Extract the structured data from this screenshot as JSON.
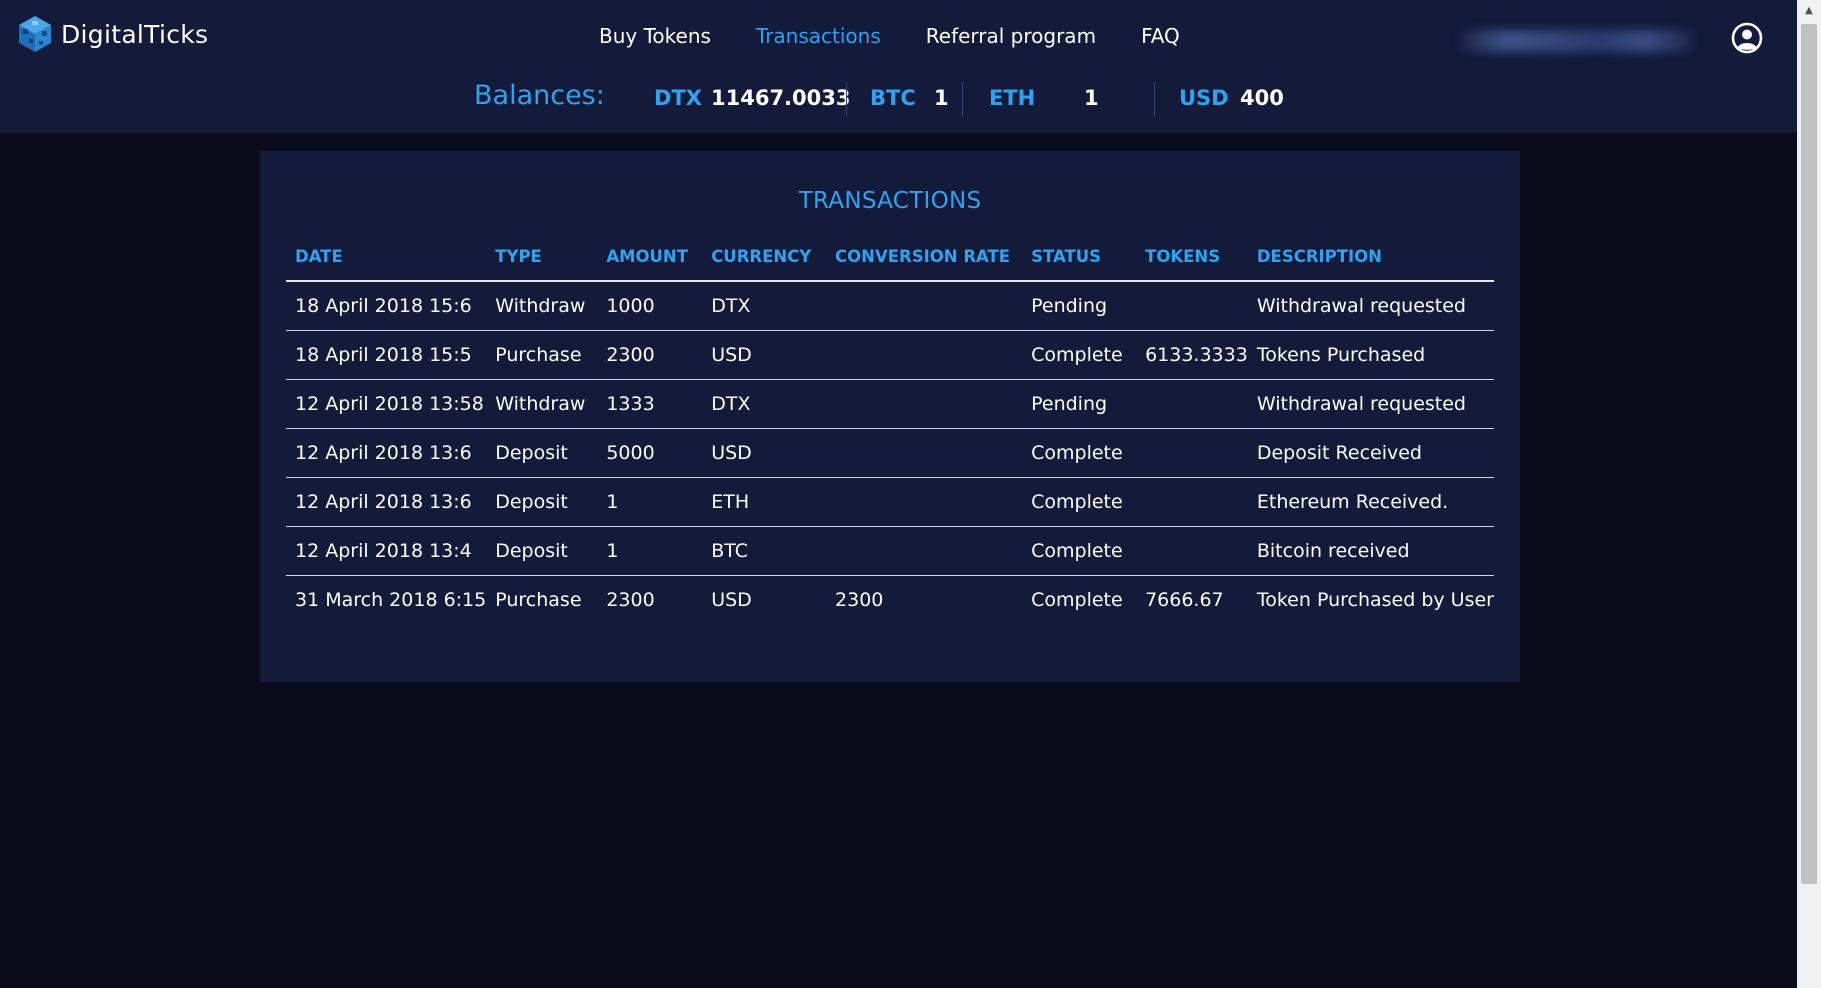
{
  "app": {
    "name": "DigitalTicks",
    "logo_icon": "cube-logo-icon"
  },
  "nav": {
    "items": [
      {
        "label": "Buy Tokens",
        "active": false
      },
      {
        "label": "Transactions",
        "active": true
      },
      {
        "label": "Referral program",
        "active": false
      },
      {
        "label": "FAQ",
        "active": false
      }
    ]
  },
  "user": {
    "icon": "user-circle-icon"
  },
  "balances": {
    "title": "Balances:",
    "items": [
      {
        "currency": "DTX",
        "value": "11467.0033"
      },
      {
        "currency": "BTC",
        "value": "1"
      },
      {
        "currency": "ETH",
        "value": "1"
      },
      {
        "currency": "USD",
        "value": "400"
      }
    ]
  },
  "transactions": {
    "title": "TRANSACTIONS",
    "columns": [
      "DATE",
      "TYPE",
      "AMOUNT",
      "CURRENCY",
      "CONVERSION RATE",
      "STATUS",
      "TOKENS",
      "DESCRIPTION"
    ],
    "rows": [
      {
        "date": "18 April 2018 15:6",
        "type": "Withdraw",
        "amount": "1000",
        "currency": "DTX",
        "conversion_rate": "",
        "status": "Pending",
        "tokens": "",
        "description": "Withdrawal requested"
      },
      {
        "date": "18 April 2018 15:5",
        "type": "Purchase",
        "amount": "2300",
        "currency": "USD",
        "conversion_rate": "",
        "status": "Complete",
        "tokens": "6133.3333",
        "description": "Tokens Purchased"
      },
      {
        "date": "12 April 2018 13:58",
        "type": "Withdraw",
        "amount": "1333",
        "currency": "DTX",
        "conversion_rate": "",
        "status": "Pending",
        "tokens": "",
        "description": "Withdrawal requested"
      },
      {
        "date": "12 April 2018 13:6",
        "type": "Deposit",
        "amount": "5000",
        "currency": "USD",
        "conversion_rate": "",
        "status": "Complete",
        "tokens": "",
        "description": "Deposit Received"
      },
      {
        "date": "12 April 2018 13:6",
        "type": "Deposit",
        "amount": "1",
        "currency": "ETH",
        "conversion_rate": "",
        "status": "Complete",
        "tokens": "",
        "description": "Ethereum Received."
      },
      {
        "date": "12 April 2018 13:4",
        "type": "Deposit",
        "amount": "1",
        "currency": "BTC",
        "conversion_rate": "",
        "status": "Complete",
        "tokens": "",
        "description": "Bitcoin received"
      },
      {
        "date": "31 March 2018 6:15",
        "type": "Purchase",
        "amount": "2300",
        "currency": "USD",
        "conversion_rate": "2300",
        "status": "Complete",
        "tokens": "7666.67",
        "description": "Token Purchased by User"
      }
    ]
  },
  "colors": {
    "accent": "#2ba4f3",
    "header_bg": "#131a3a",
    "page_bg": "#0a0c1c"
  }
}
